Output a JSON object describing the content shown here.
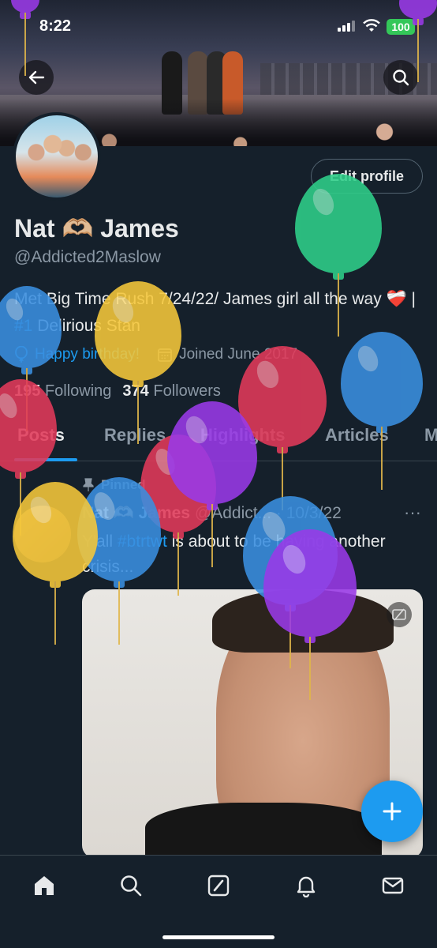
{
  "status_bar": {
    "time": "8:22",
    "battery": "100"
  },
  "profile": {
    "name": "Nat 🫶🏼 James",
    "handle": "@Addicted2Maslow",
    "edit_label": "Edit profile",
    "bio_text": "Met Big Time Rush 7/24/22/ James girl all the way ",
    "bio_heart": "❤️‍🩹",
    "bio_sep": " | ",
    "bio_link": "#1",
    "bio_end": " Delirious Stan",
    "birthday": "Happy birthday!",
    "joined": "Joined June 2017",
    "following_count": "195",
    "following_label": "Following",
    "followers_count": "374",
    "followers_label": "Followers"
  },
  "tabs": [
    "Posts",
    "Replies",
    "Highlights",
    "Articles",
    "M"
  ],
  "post": {
    "pinned_label": "Pinned",
    "author": "Nat 🫶🏼 James",
    "handle_date": "@Addict... · 10/3/22",
    "more": "···",
    "text_pre": "Y'all ",
    "hashtag": "#btrtwt",
    "text_post": " is about to be having another crisis..."
  },
  "colors": {
    "accent": "#1d9bf0",
    "background": "#15202b",
    "battery": "#34c759"
  },
  "nav_icons": [
    "home-icon",
    "search-icon",
    "grok-icon",
    "notifications-icon",
    "messages-icon"
  ]
}
